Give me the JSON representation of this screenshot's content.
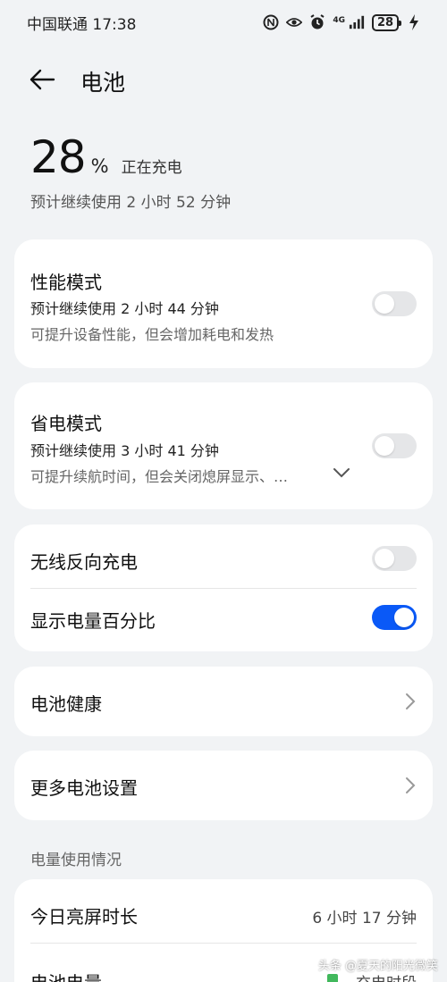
{
  "status_bar": {
    "carrier_time": "中国联通 17:38",
    "network": "4G",
    "battery": "28"
  },
  "header": {
    "title": "电池"
  },
  "summary": {
    "percent": "28",
    "percent_sign": "%",
    "status": "正在充电",
    "remaining": "预计继续使用 2 小时 52 分钟"
  },
  "performance_mode": {
    "title": "性能模式",
    "estimate": "预计继续使用 2 小时 44 分钟",
    "desc": "可提升设备性能，但会增加耗电和发热",
    "enabled": false
  },
  "power_saving_mode": {
    "title": "省电模式",
    "estimate": "预计继续使用 3 小时 41 分钟",
    "desc": "可提升续航时间，但会关闭熄屏显示、…",
    "enabled": false
  },
  "toggles": {
    "wireless_reverse": {
      "label": "无线反向充电",
      "enabled": false
    },
    "show_percentage": {
      "label": "显示电量百分比",
      "enabled": true
    }
  },
  "links": {
    "battery_health": "电池健康",
    "more_settings": "更多电池设置"
  },
  "usage": {
    "section_title": "电量使用情况",
    "screen_time_label": "今日亮屏时长",
    "screen_time_value": "6 小时 17 分钟",
    "battery_level_label": "电池电量",
    "legend_charging": "充电时段"
  },
  "watermark": "头条 @夏天的阳光微笑",
  "colors": {
    "accent": "#0a59f7",
    "background": "#f1f3f5",
    "card": "#ffffff",
    "legend_green": "#41b85c"
  }
}
